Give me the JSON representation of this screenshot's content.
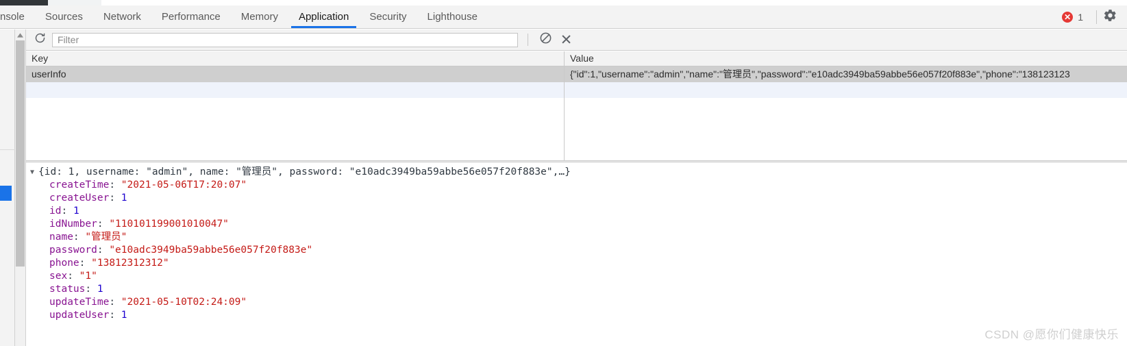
{
  "colors": {
    "accent": "#1a73e8",
    "error_red": "#e53935",
    "selected_row": "#cfcfcf",
    "alt_row": "#eff3fb",
    "toolbar_bg": "#f3f3f3",
    "prop_name": "#881391",
    "string_value": "#c41a16",
    "number_value": "#1c00cf"
  },
  "tabstrip": {
    "tabs": [
      {
        "label": "nsole",
        "name": "tab-console",
        "active": false,
        "clipped": true
      },
      {
        "label": "Sources",
        "name": "tab-sources",
        "active": false,
        "clipped": false
      },
      {
        "label": "Network",
        "name": "tab-network",
        "active": false,
        "clipped": false
      },
      {
        "label": "Performance",
        "name": "tab-performance",
        "active": false,
        "clipped": false
      },
      {
        "label": "Memory",
        "name": "tab-memory",
        "active": false,
        "clipped": false
      },
      {
        "label": "Application",
        "name": "tab-application",
        "active": true,
        "clipped": false
      },
      {
        "label": "Security",
        "name": "tab-security",
        "active": false,
        "clipped": false
      },
      {
        "label": "Lighthouse",
        "name": "tab-lighthouse",
        "active": false,
        "clipped": false
      }
    ],
    "error_count": "1",
    "error_glyph": "✕",
    "settings_icon": "gear-icon"
  },
  "toolbar": {
    "refresh_icon": "refresh-icon",
    "filter_placeholder": "Filter",
    "filter_value": "",
    "clear_filter_icon": "no-entry-icon",
    "delete_icon": "close-icon",
    "delete_glyph": "✕"
  },
  "table": {
    "columns": [
      "Key",
      "Value"
    ],
    "rows": [
      {
        "key": "userInfo",
        "value": "{\"id\":1,\"username\":\"admin\",\"name\":\"管理员\",\"password\":\"e10adc3949ba59abbe56e057f20f883e\",\"phone\":\"138123123",
        "selected": true
      }
    ]
  },
  "preview": {
    "disclosure_glyph": "▼",
    "object_summary": "{id: 1, username: \"admin\", name: \"管理员\", password: \"e10adc3949ba59abbe56e057f20f883e\",…}",
    "properties": [
      {
        "name": "createTime",
        "value": "\"2021-05-06T17:20:07\"",
        "type": "string"
      },
      {
        "name": "createUser",
        "value": "1",
        "type": "number"
      },
      {
        "name": "id",
        "value": "1",
        "type": "number"
      },
      {
        "name": "idNumber",
        "value": "\"110101199001010047\"",
        "type": "string"
      },
      {
        "name": "name",
        "value": "\"管理员\"",
        "type": "string"
      },
      {
        "name": "password",
        "value": "\"e10adc3949ba59abbe56e057f20f883e\"",
        "type": "string"
      },
      {
        "name": "phone",
        "value": "\"13812312312\"",
        "type": "string"
      },
      {
        "name": "sex",
        "value": "\"1\"",
        "type": "string"
      },
      {
        "name": "status",
        "value": "1",
        "type": "number"
      },
      {
        "name": "updateTime",
        "value": "\"2021-05-10T02:24:09\"",
        "type": "string"
      },
      {
        "name": "updateUser",
        "value": "1",
        "type": "number"
      }
    ]
  },
  "watermark": {
    "text": "CSDN @愿你们健康快乐"
  }
}
